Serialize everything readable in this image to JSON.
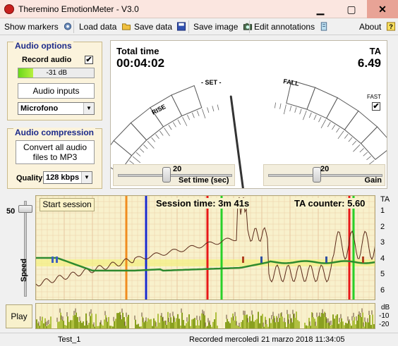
{
  "window": {
    "title": "Theremino EmotionMeter - V3.0",
    "minimize": "▁",
    "maximize": "▢",
    "close": "✕"
  },
  "toolbar": {
    "show_markers": "Show markers",
    "load_data": "Load data",
    "save_data": "Save data",
    "save_image": "Save image",
    "edit_annotations": "Edit annotations",
    "about": "About"
  },
  "audio_options": {
    "title": "Audio options",
    "record_audio": "Record audio",
    "record_checked": true,
    "level_label": "-31 dB",
    "level_fraction": 0.2,
    "inputs_button": "Audio inputs",
    "input_device": "Microfono"
  },
  "audio_compression": {
    "title": "Audio compression",
    "convert_button": "Convert all audio files to MP3",
    "quality_label": "Quality",
    "quality_value": "128 kbps"
  },
  "meter": {
    "total_time_label": "Total time",
    "total_time_value": "00:04:02",
    "ta_label": "TA",
    "ta_value": "6.49",
    "rise_label": "RISE",
    "set_label": "- SET -",
    "fall_label": "FALL",
    "fast_label": "FAST",
    "fast_checked": true,
    "set_time_label": "Set time (sec)",
    "set_time_value": "20",
    "set_time_fraction": 0.42,
    "gain_label": "Gain",
    "gain_value": "20",
    "gain_fraction": 0.42,
    "needle_fraction": 0.55
  },
  "session": {
    "start_button": "Start session",
    "session_time_label": "Session time: 3m 41s",
    "ta_counter_label": "TA counter: 5.60",
    "speed_label": "Speed",
    "speed_value": "50",
    "speed_fraction": 0.95,
    "ta_axis_title": "TA",
    "ta_ticks": [
      "1",
      "2",
      "3",
      "4",
      "5",
      "6"
    ],
    "play_button": "Play",
    "db_axis_title": "dB",
    "db_ticks": [
      "-10",
      "-20"
    ]
  },
  "status": {
    "file_name": "Test_1",
    "recorded": "Recorded mercoledì 21 marzo 2018 11:34:05"
  },
  "colors": {
    "panel_bg": "#fbf3dc",
    "chart_bg": "#f8f1cc",
    "title_blue": "#1c2a8a",
    "marker_orange": "#f08c1e",
    "marker_blue": "#1a2ad0",
    "marker_red": "#e81818",
    "marker_green": "#28d028",
    "tone_line": "#2e8a2e",
    "signal_line": "#5a2a1a"
  }
}
